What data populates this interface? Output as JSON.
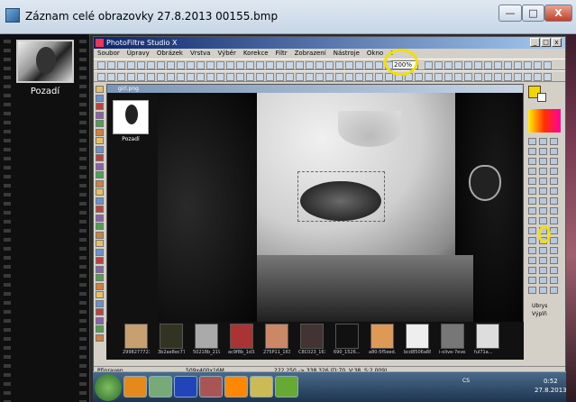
{
  "window": {
    "title": "Záznam celé obrazovky 27.8.2013 00155.bmp",
    "min": "—",
    "max": "□",
    "close": "X"
  },
  "left_panel": {
    "layer_label": "Pozadí"
  },
  "app": {
    "title": "PhotoFiltre Studio X",
    "menu": [
      "Soubor",
      "Úpravy",
      "Obrázek",
      "Vrstva",
      "Výběr",
      "Korekce",
      "Filtr",
      "Zobrazení",
      "Nástroje",
      "Okno",
      "?"
    ],
    "zoom_value": "200%"
  },
  "document": {
    "title": "girl.png",
    "layer_label": "Pozadí"
  },
  "side_options": {
    "opt1": "Ubrys",
    "opt2": "Výplň"
  },
  "filmstrip": {
    "captions": [
      "2998277723...",
      "3b2ae8ec77...",
      "50218b_219...",
      "ac9f8b_1d3...",
      "275P11_163...",
      "C8C023_163...",
      "690_1526...",
      "a80-5f5eed...",
      "bcd8506a88...",
      "i-olive-7eve...",
      "ful71a..."
    ]
  },
  "status": {
    "left": "Připraven",
    "size": "509x400x16M",
    "coords": "222,250 -> 338,326 (D:70, V:38, S:2,009)"
  },
  "taskbar": {
    "tray": "CS",
    "time": "0:52",
    "date": "27.8.2013"
  },
  "colors": {
    "highlight": "#f3e000",
    "titlebar": "#0a246a"
  }
}
